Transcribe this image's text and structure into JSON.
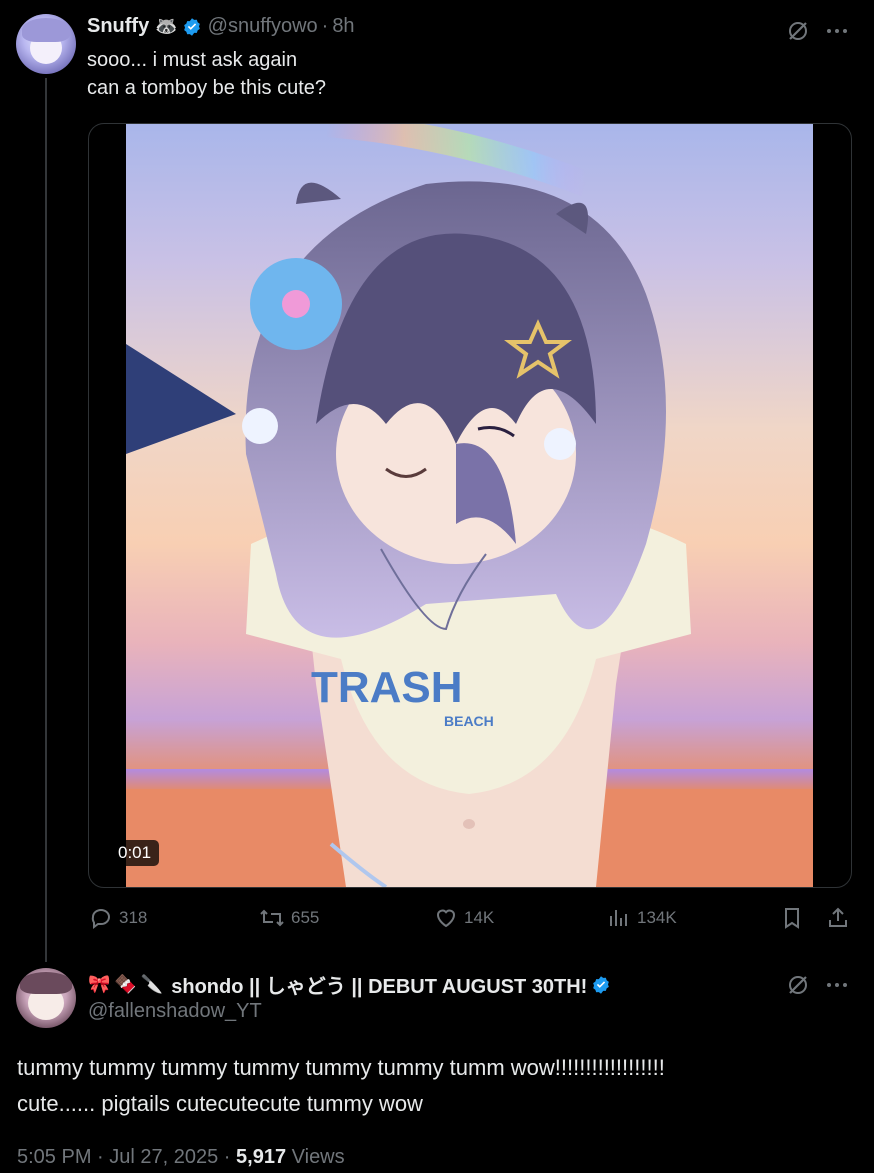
{
  "tweet": {
    "display_name": "Snuffy",
    "name_emoji": "🦝",
    "handle": "@snuffyowo",
    "time": "8h",
    "text_lines": [
      "sooo... i must ask again",
      "can a tomboy be this cute?"
    ],
    "video_time": "0:01",
    "shirt_text": "TRASH",
    "shirt_subtext": "BEACH",
    "stats": {
      "replies": "318",
      "reposts": "655",
      "likes": "14K",
      "views": "134K"
    }
  },
  "reply": {
    "emoji_prefix": "🎀🍫🔪",
    "display_name": "shondo || しゃどう || DEBUT AUGUST 30TH!",
    "handle": "@fallenshadow_YT",
    "text_lines": [
      "tummy tummy tummy tummy tummy tummy tumm wow!!!!!!!!!!!!!!!!!!",
      "cute...... pigtails cutecutecute tummy wow"
    ],
    "date_time": "5:05 PM · Jul 27, 2025 · ",
    "views_count": "5,917",
    "views_label": "Views"
  },
  "icons": {
    "more": "more-icon",
    "grok": "grok-icon",
    "verified": "verified-badge-icon"
  },
  "colors": {
    "verified": "#1d9bf0",
    "muted": "#71767b",
    "text": "#e7e9ea",
    "background": "#000000"
  }
}
